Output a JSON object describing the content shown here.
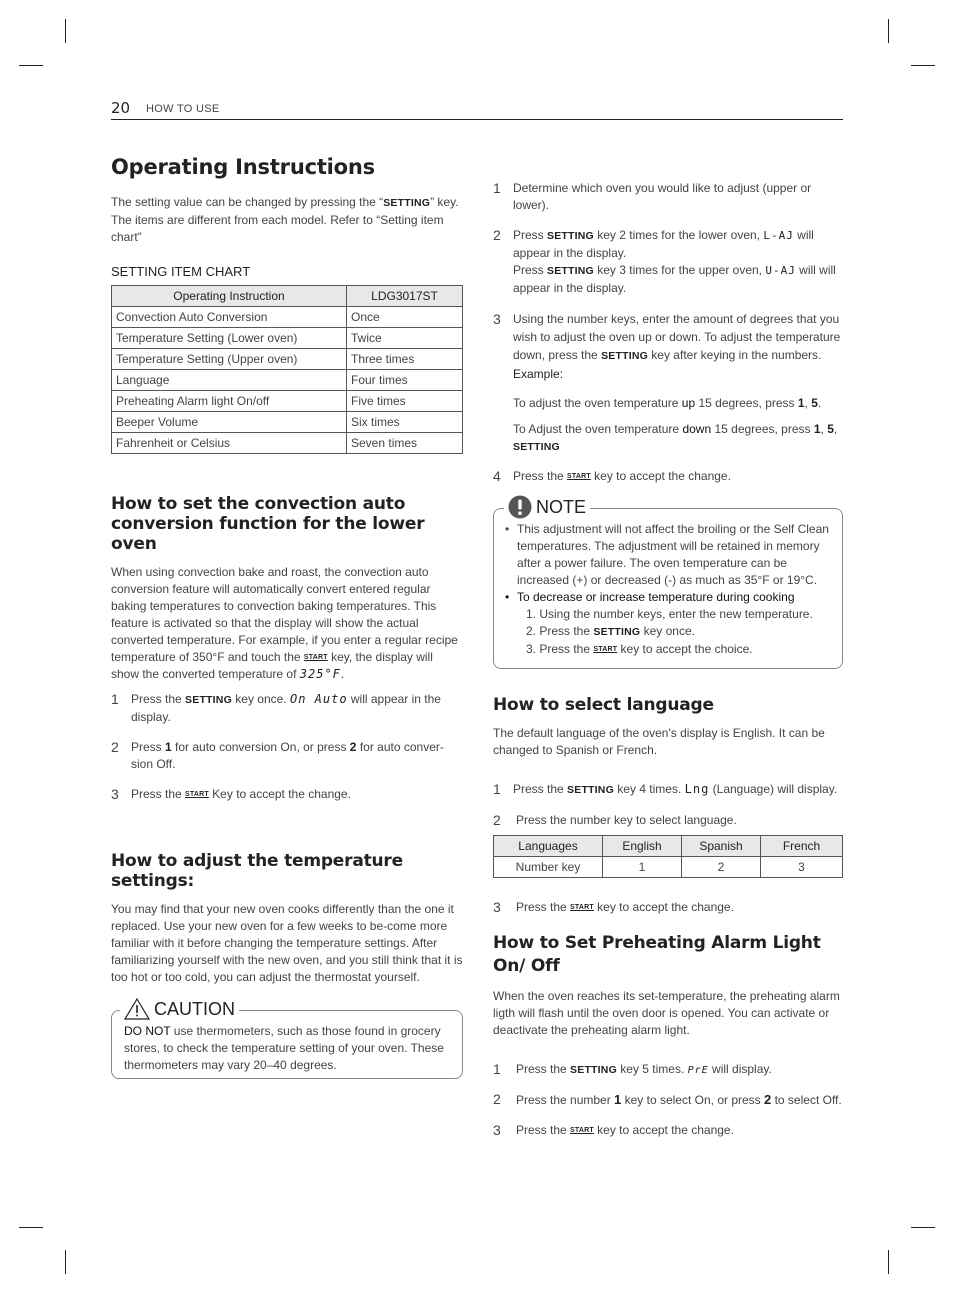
{
  "header": {
    "page_number": "20",
    "section": "HOW TO USE"
  },
  "title": "Operating Instructions",
  "intro": {
    "line1_pre": "The setting value can be changed by pressing the “",
    "line1_key": "SETTING",
    "line1_post": "” key.",
    "line2": "The items are different from each model. Refer to “Setting item chart”"
  },
  "setting_chart": {
    "title": "SETTING ITEM CHART",
    "headers": [
      "Operating Instruction",
      "LDG3017ST"
    ],
    "rows": [
      [
        "Convection Auto Conversion",
        "Once"
      ],
      [
        "Temperature Setting (Lower oven)",
        "Twice"
      ],
      [
        "Temperature Setting (Upper oven)",
        "Three times"
      ],
      [
        "Language",
        "Four times"
      ],
      [
        "Preheating Alarm light On/off",
        "Five times"
      ],
      [
        "Beeper Volume",
        "Six times"
      ],
      [
        "Fahrenheit or Celsius",
        "Seven times"
      ]
    ]
  },
  "keys": {
    "setting": "SETTING",
    "start": "START"
  },
  "convection": {
    "heading": "How to set the convection auto conversion function for the lower oven",
    "body_pre": "When using convection bake and roast, the convection auto conversion feature will automatically convert entered regular baking temperatures to convection baking temperatures. This feature is activated so that the display will show the actual converted temperature. For example, if you enter a regular recipe temperature of 350°F and touch the ",
    "body_mid": " key, the display will show the converted temperature of ",
    "display_temp": "325°F",
    "body_end": ".",
    "steps": [
      {
        "num": "1",
        "pre": "Press the ",
        "post1": " key once. ",
        "display": "On Auto",
        "post2": " will appear in the display."
      },
      {
        "num": "2",
        "pre": "Press ",
        "b1": "1",
        "mid": " for auto conversion On, or press ",
        "b2": "2",
        "post": " for auto conver-sion Off."
      },
      {
        "num": "3",
        "pre": "Press the ",
        "post": " Key to accept the change."
      }
    ]
  },
  "temperature": {
    "heading": "How to adjust the temperature settings:",
    "body": "You may find that your new oven cooks differently than the one it replaced. Use your new oven for a few weeks to be-come more familiar with it before changing the temperature settings. After familiarizing yourself with the new oven, and you still think that it is too hot or too cold, you can adjust the thermostat yourself.",
    "caution": {
      "label": "CAUTION",
      "bold": "DO NOT",
      "text": " use thermometers, such as those found in grocery stores, to check the temperature setting of your oven. These thermometers may vary 20–40 degrees."
    },
    "steps": [
      {
        "num": "1",
        "text": "Determine which oven you would like to adjust (upper or lower)."
      },
      {
        "num": "2",
        "a_pre": "Press ",
        "a_post": " key 2 times for the lower oven, ",
        "a_display": "L-AJ",
        "a_end": " will appear in the display.",
        "b_pre": "Press ",
        "b_post": " key 3 times for the upper oven, ",
        "b_display": "U-AJ",
        "b_end": " will will appear in the display."
      },
      {
        "num": "3",
        "pre": "Using the number keys, enter the amount of degrees that you wish to adjust the oven up or down. To adjust the temperature down, press the ",
        "post": " key after keying in the numbers. ",
        "example": "Example:"
      },
      {
        "num": "4",
        "pre": "Press the ",
        "post": " key to accept the change."
      }
    ],
    "example_up": {
      "pre": "To adjust the oven temperature ",
      "dir": "up",
      "mid": " 15 degrees, press ",
      "k1": "1",
      "sep": ", ",
      "k2": "5",
      "end": "."
    },
    "example_down": {
      "pre": "To Adjust the oven temperature ",
      "dir": "down",
      "mid": " 15 degrees, press ",
      "k1": "1",
      "sep": ", ",
      "k2": "5",
      "sep2": ", ",
      "k3": "SETTING"
    },
    "note": {
      "label": "NOTE",
      "bullet1": "This adjustment will not affect the broiling or the Self Clean temperatures. The adjustment will be retained in memory after a power failure. The oven temperature can be increased (+) or decreased (-) as much as 35°F or 19°C.",
      "bullet2": "To decrease or increase temperature during cooking",
      "sub1": "1. Using the number keys, enter the new temperature.",
      "sub2_pre": "2. Press the ",
      "sub2_post": " key once.",
      "sub3_pre": "3. Press the ",
      "sub3_post": " key to accept the choice."
    }
  },
  "language": {
    "heading": "How to select language",
    "body": "The default language of the oven's display is English. It can be changed to Spanish or French.",
    "step1": {
      "num": "1",
      "pre": "Press the ",
      "post": " key 4 times. ",
      "display": "Lng",
      "end": " (Language) will display."
    },
    "step2": {
      "num": "2",
      "text": "Press the number key to select language."
    },
    "table": {
      "headers": [
        "Languages",
        "English",
        "Spanish",
        "French"
      ],
      "row": [
        "Number key",
        "1",
        "2",
        "3"
      ]
    },
    "step3": {
      "num": "3",
      "pre": "Press the ",
      "post": " key to accept the change."
    }
  },
  "preheat": {
    "heading": "How to Set Preheating Alarm Light On/ Off",
    "body": "When the oven reaches its set-temperature, the preheating alarm ligth will flash until the oven door is opened. You can activate or deactivate the preheating alarm light.",
    "step1": {
      "num": "1",
      "pre": "Press the ",
      "post": " key 5 times. ",
      "display": "PrE",
      "end": " will display."
    },
    "step2": {
      "num": "2",
      "pre": "Press the number ",
      "b1": "1",
      "mid": " key to select On, or press ",
      "b2": "2",
      "post": " to select Off."
    },
    "step3": {
      "num": "3",
      "pre": "Press the ",
      "post": " key to accept the change."
    }
  }
}
